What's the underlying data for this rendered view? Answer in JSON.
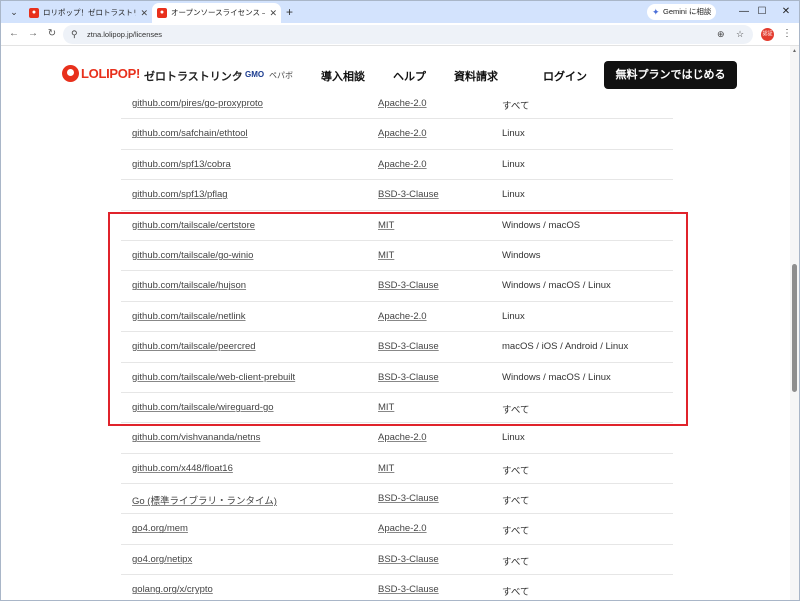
{
  "browser": {
    "tabs": [
      {
        "title": "ロリポップ！ゼロトラストリンク byGM",
        "active": false
      },
      {
        "title": "オープンソースライセンス — ロリポップ！",
        "active": true
      }
    ],
    "new_tab": "+",
    "gemini_label": "Gemini に相談",
    "url": "ztna.lolipop.jp/licenses",
    "profile_initials": "認証",
    "window": {
      "minimize": "—",
      "maximize": "☐",
      "close": "✕"
    }
  },
  "site": {
    "logo_text": "LOLIPOP!",
    "logo_sub": "ゼロトラストリンク",
    "logo_by": "by",
    "logo_gmo": "GMO",
    "logo_pepabo": "ペパボ",
    "nav": [
      "導入相談",
      "ヘルプ",
      "資料請求",
      "ログイン"
    ],
    "cta": "無料プランではじめる",
    "colors": {
      "brand": "#e8301c",
      "highlight": "#e0232b",
      "cta_bg": "#111111"
    }
  },
  "licenses": [
    {
      "name": "github.com/pires/go-proxyproto",
      "license": "Apache-2.0",
      "platform": "すべて"
    },
    {
      "name": "github.com/safchain/ethtool",
      "license": "Apache-2.0",
      "platform": "Linux"
    },
    {
      "name": "github.com/spf13/cobra",
      "license": "Apache-2.0",
      "platform": "Linux"
    },
    {
      "name": "github.com/spf13/pflag",
      "license": "BSD-3-Clause",
      "platform": "Linux"
    },
    {
      "name": "github.com/tailscale/certstore",
      "license": "MIT",
      "platform": "Windows / macOS"
    },
    {
      "name": "github.com/tailscale/go-winio",
      "license": "MIT",
      "platform": "Windows"
    },
    {
      "name": "github.com/tailscale/hujson",
      "license": "BSD-3-Clause",
      "platform": "Windows / macOS / Linux"
    },
    {
      "name": "github.com/tailscale/netlink",
      "license": "Apache-2.0",
      "platform": "Linux"
    },
    {
      "name": "github.com/tailscale/peercred",
      "license": "BSD-3-Clause",
      "platform": "macOS / iOS / Android / Linux"
    },
    {
      "name": "github.com/tailscale/web-client-prebuilt",
      "license": "BSD-3-Clause",
      "platform": "Windows / macOS / Linux"
    },
    {
      "name": "github.com/tailscale/wireguard-go",
      "license": "MIT",
      "platform": "すべて"
    },
    {
      "name": "github.com/vishvananda/netns",
      "license": "Apache-2.0",
      "platform": "Linux"
    },
    {
      "name": "github.com/x448/float16",
      "license": "MIT",
      "platform": "すべて"
    },
    {
      "name": "Go (標準ライブラリ・ランタイム)",
      "license": "BSD-3-Clause",
      "platform": "すべて"
    },
    {
      "name": "go4.org/mem",
      "license": "Apache-2.0",
      "platform": "すべて"
    },
    {
      "name": "go4.org/netipx",
      "license": "BSD-3-Clause",
      "platform": "すべて"
    },
    {
      "name": "golang.org/x/crypto",
      "license": "BSD-3-Clause",
      "platform": "すべて"
    }
  ]
}
